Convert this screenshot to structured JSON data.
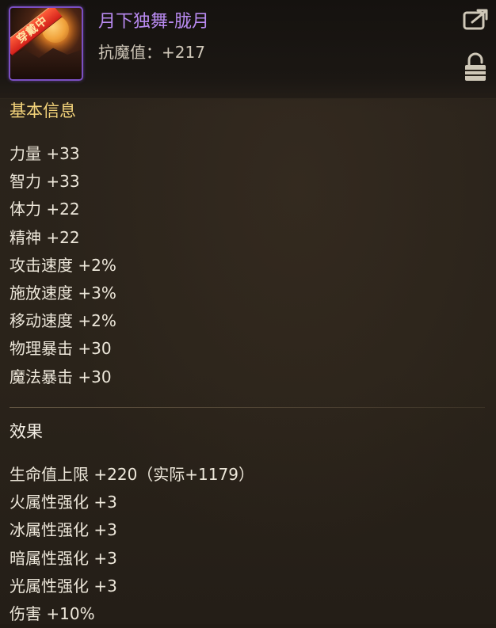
{
  "item": {
    "badge": "穿戴中",
    "name": "月下独舞-胧月",
    "stat_label": "抗魔值：+217"
  },
  "icons": {
    "share": "share-icon",
    "lock": "lock-icon"
  },
  "sections": {
    "basic_title": "基本信息",
    "basic_attributes": [
      "力量 +33",
      "智力 +33",
      "体力 +22",
      "精神 +22",
      "攻击速度 +2%",
      "施放速度 +3%",
      "移动速度 +2%",
      "物理暴击 +30",
      "魔法暴击 +30"
    ],
    "effect_title": "效果",
    "effect_attributes": [
      "生命值上限 +220（实际+1179）",
      "火属性强化 +3",
      "冰属性强化 +3",
      "暗属性强化 +3",
      "光属性强化 +3",
      "伤害 +10%"
    ]
  },
  "colors": {
    "item_name": "#b88af0",
    "section_title": "#f2d27a",
    "badge": "#d3201a",
    "icon_border": "#7b4fc2"
  }
}
